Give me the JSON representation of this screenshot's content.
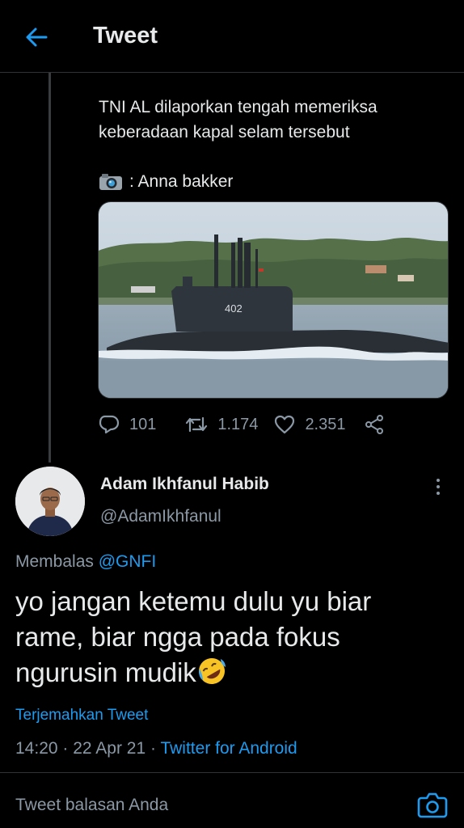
{
  "header": {
    "title": "Tweet",
    "back_icon": "arrow-left-icon"
  },
  "parent_tweet": {
    "text": "TNI AL dilaporkan tengah memeriksa keberadaan kapal selam tersebut",
    "credit": ": Anna bakker",
    "credit_icon": "camera-emoji",
    "media_label": "402",
    "stats": {
      "replies": "101",
      "retweets": "1.174",
      "likes": "2.351"
    }
  },
  "reply": {
    "display_name": "Adam Ikhfanul Habib",
    "handle": "@AdamIkhfanul",
    "replying_prefix": "Membalas",
    "replying_to": "@GNFI",
    "text": "yo jangan ketemu dulu yu biar rame, biar ngga pada fokus ngurusin mudik",
    "emoji": "rolling-on-floor-laughing-emoji",
    "translate_label": "Terjemahkan Tweet",
    "time": "14:20",
    "date": "22 Apr 21",
    "separator": "·",
    "source": "Twitter for Android"
  },
  "composer": {
    "placeholder": "Tweet balasan Anda",
    "camera_icon": "camera-icon"
  },
  "colors": {
    "background": "#000000",
    "accent": "#1d9bf0",
    "secondary_text": "#8b98a5",
    "primary_text": "#e7e9ea"
  }
}
